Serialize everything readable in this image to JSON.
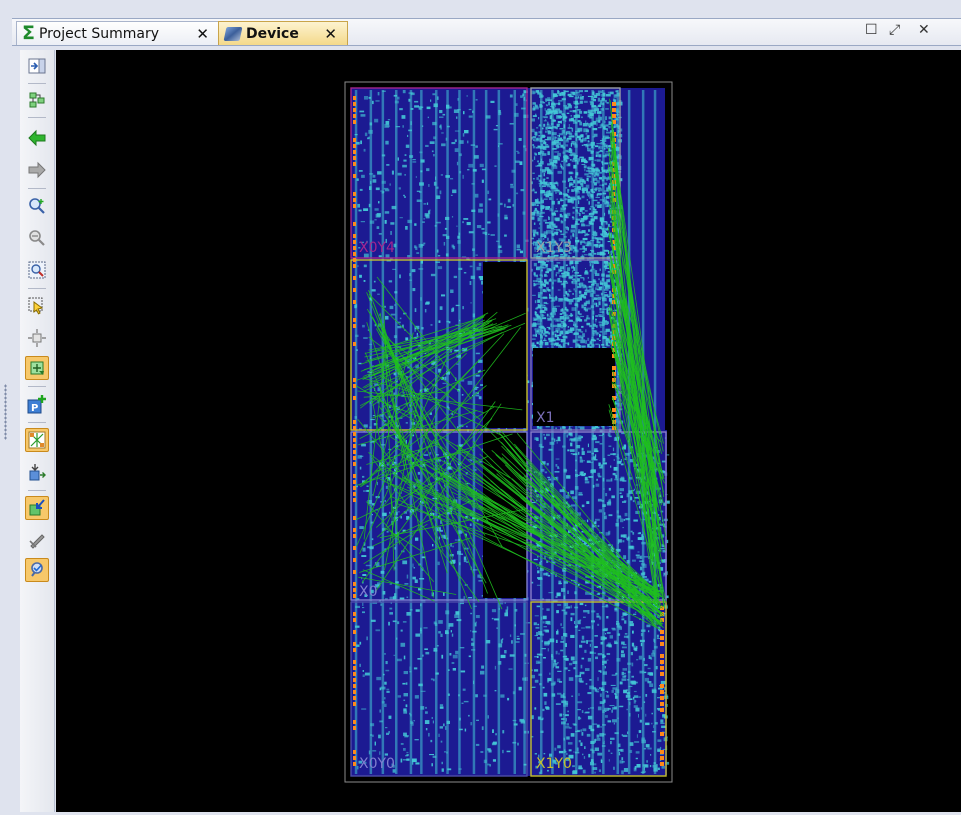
{
  "tabs": [
    {
      "label": "Project Summary",
      "close": "✕"
    },
    {
      "label": "Device",
      "close": "✕"
    }
  ],
  "window_controls": {
    "maximize": "☐",
    "float": "⤢",
    "close": "✕"
  },
  "toolbar": {
    "icons": [
      "expand-panel-icon",
      "auto-fit-icon",
      "back-arrow-icon",
      "forward-arrow-icon",
      "zoom-in-icon",
      "zoom-out-icon",
      "zoom-fit-icon",
      "select-area-icon",
      "move-icon",
      "route-icon",
      "add-pblock-icon",
      "show-nets-icon",
      "place-icon",
      "highlight-icon",
      "unplace-icon",
      "pin-icon"
    ]
  },
  "device": {
    "clock_regions": [
      "X0Y4",
      "X1Y3",
      "X1",
      "X0",
      "X0Y0",
      "X1Y0"
    ],
    "colors": {
      "background": "#000000",
      "fabric": "#1c1a92",
      "logic": "#43c6d6",
      "nets": "#1fbf1f",
      "io": "#ff8a1a"
    }
  }
}
